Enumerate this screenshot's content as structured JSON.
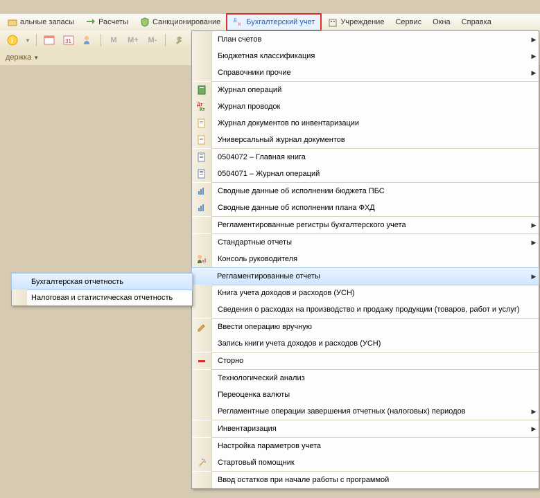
{
  "menubar": {
    "material_reserves": "альные запасы",
    "settlements": "Расчеты",
    "sanctioning": "Санкционирование",
    "accounting": "Бухгалтерский учет",
    "institution": "Учреждение",
    "service": "Сервис",
    "windows": "Окна",
    "help": "Справка"
  },
  "toolbar": {
    "m": "M",
    "m_plus": "M+",
    "m_minus": "M-"
  },
  "tabbar": {
    "support": "держка"
  },
  "dropdown": [
    {
      "id": "chart-of-accounts",
      "label": "План счетов",
      "arrow": true
    },
    {
      "id": "budget-classification",
      "label": "Бюджетная классификация",
      "arrow": true
    },
    {
      "id": "other-refs",
      "label": "Справочники прочие",
      "arrow": true,
      "sep": true
    },
    {
      "id": "op-journal",
      "label": "Журнал операций",
      "icon": "book-green"
    },
    {
      "id": "posting-journal",
      "label": "Журнал проводок",
      "icon": "dk"
    },
    {
      "id": "inv-doc-journal",
      "label": "Журнал документов по инвентаризации",
      "icon": "doc"
    },
    {
      "id": "universal-journal",
      "label": "Универсальный журнал документов",
      "icon": "doc",
      "sep": true
    },
    {
      "id": "form-0504072",
      "label": "0504072 – Главная книга",
      "icon": "form"
    },
    {
      "id": "form-0504071",
      "label": "0504071 – Журнал операций",
      "icon": "form",
      "sep": true
    },
    {
      "id": "summary-pbc",
      "label": "Сводные данные об исполнении бюджета ПБС",
      "icon": "bar"
    },
    {
      "id": "summary-fhd",
      "label": "Сводные данные об исполнении плана ФХД",
      "icon": "bar",
      "sep": true
    },
    {
      "id": "reg-registers",
      "label": "Регламентированные регистры бухгалтерского учета",
      "arrow": true,
      "sep": true
    },
    {
      "id": "std-reports",
      "label": "Стандартные отчеты",
      "arrow": true
    },
    {
      "id": "mgr-console",
      "label": "Консоль руководителя",
      "icon": "mgr",
      "sep": true
    },
    {
      "id": "reg-reports",
      "label": "Регламентированные отчеты",
      "arrow": true,
      "selected": true,
      "hl": true
    },
    {
      "id": "usn-book",
      "label": "Книга учета доходов и расходов (УСН)"
    },
    {
      "id": "expense-info",
      "label": "Сведения о расходах на производство и продажу продукции (товаров, работ и услуг)",
      "sep": true
    },
    {
      "id": "manual-op",
      "label": "Ввести операцию вручную",
      "icon": "pencil"
    },
    {
      "id": "usn-record",
      "label": "Запись книги учета доходов и расходов (УСН)",
      "sep": true
    },
    {
      "id": "storno",
      "label": "Сторно",
      "icon": "minus",
      "sep": true
    },
    {
      "id": "tech-analysis",
      "label": "Технологический анализ"
    },
    {
      "id": "currency-reval",
      "label": "Переоценка валюты"
    },
    {
      "id": "period-ops",
      "label": "Регламентные операции завершения отчетных (налоговых) периодов",
      "arrow": true,
      "sep": true
    },
    {
      "id": "inventory",
      "label": "Инвентаризация",
      "arrow": true,
      "sep": true
    },
    {
      "id": "acct-settings",
      "label": "Настройка параметров учета"
    },
    {
      "id": "start-helper",
      "label": "Стартовый помощник",
      "icon": "wand",
      "sep": true
    },
    {
      "id": "initial-balances",
      "label": "Ввод остатков при начале работы с программой"
    }
  ],
  "submenu": {
    "accounting_reports": "Бухгалтерская отчетность",
    "tax_stat_reports": "Налоговая и статистическая отчетность"
  }
}
